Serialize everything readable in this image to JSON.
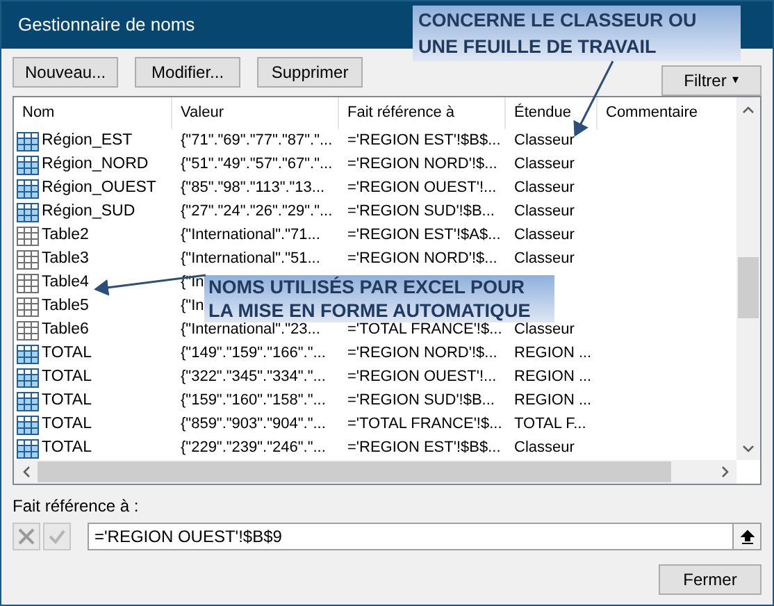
{
  "window": {
    "title": "Gestionnaire de noms"
  },
  "buttons": [
    "Nouveau...",
    "Modifier...",
    "Supprimer"
  ],
  "filter_button": {
    "label": "Filtrer",
    "caret": "▾"
  },
  "table": {
    "columns": [
      "Nom",
      "Valeur",
      "Fait référence à",
      "Étendue",
      "Commentaire"
    ],
    "rows": [
      {
        "kind": "range",
        "selected": false,
        "name": "Région_EST",
        "value": "{\"71\".\"69\".\"77\".\"87\".\"...",
        "refers_to": "='REGION EST'!$B$...",
        "scope": "Classeur"
      },
      {
        "kind": "range",
        "selected": false,
        "name": "Région_NORD",
        "value": "{\"51\".\"49\".\"57\".\"67\".\"...",
        "refers_to": "='REGION NORD'!$...",
        "scope": "Classeur"
      },
      {
        "kind": "range",
        "selected": false,
        "name": "Région_OUEST",
        "value": "{\"85\".\"98\".\"113\".\"13...",
        "refers_to": "='REGION OUEST'!...",
        "scope": "Classeur"
      },
      {
        "kind": "range",
        "selected": false,
        "name": "Région_SUD",
        "value": "{\"27\".\"24\".\"26\".\"29\".\"...",
        "refers_to": "='REGION SUD'!$B...",
        "scope": "Classeur"
      },
      {
        "kind": "table",
        "selected": false,
        "name": "Table2",
        "value": "{\"International\".\"71...",
        "refers_to": "='REGION EST'!$A$...",
        "scope": "Classeur"
      },
      {
        "kind": "table",
        "selected": false,
        "name": "Table3",
        "value": "{\"International\".\"51...",
        "refers_to": "='REGION NORD'!$...",
        "scope": "Classeur"
      },
      {
        "kind": "table",
        "selected": false,
        "name": "Table4",
        "value": "{\"In"
      },
      {
        "kind": "table",
        "selected": false,
        "name": "Table5",
        "value": "{\"In"
      },
      {
        "kind": "table",
        "selected": false,
        "name": "Table6",
        "value": "{\"International\".\"23...",
        "refers_to": "='TOTAL FRANCE'!$...",
        "scope": "Classeur"
      },
      {
        "kind": "range",
        "selected": false,
        "name": "TOTAL",
        "value": "{\"149\".\"159\".\"166\".\"...",
        "refers_to": "='REGION NORD'!$...",
        "scope": "REGION ..."
      },
      {
        "kind": "range",
        "selected": false,
        "name": "TOTAL",
        "value": "{\"322\".\"345\".\"334\".\"...",
        "refers_to": "='REGION OUEST'!...",
        "scope": "REGION ..."
      },
      {
        "kind": "range",
        "selected": false,
        "name": "TOTAL",
        "value": "{\"159\".\"160\".\"158\".\"...",
        "refers_to": "='REGION SUD'!$B...",
        "scope": "REGION ..."
      },
      {
        "kind": "range",
        "selected": false,
        "name": "TOTAL",
        "value": "{\"859\".\"903\".\"904\".\"...",
        "refers_to": "='TOTAL FRANCE'!$...",
        "scope": "TOTAL F..."
      },
      {
        "kind": "range",
        "selected": false,
        "name": "TOTAL",
        "value": "{\"229\".\"239\".\"246\".\"...",
        "refers_to": "='REGION EST'!$B$...",
        "scope": "Classeur"
      }
    ]
  },
  "refers_to_field": {
    "label": "Fait référence à :",
    "value": "='REGION OUEST'!$B$9",
    "cancel_disabled": true,
    "confirm_disabled": true
  },
  "close_button": "Fermer",
  "callouts": [
    {
      "text": "CONCERNE LE CLASSEUR OU UNE FEUILLE DE TRAVAIL"
    },
    {
      "text": "NOMS UTILISÉS PAR EXCEL POUR LA MISE EN FORME AUTOMATIQUE"
    }
  ]
}
